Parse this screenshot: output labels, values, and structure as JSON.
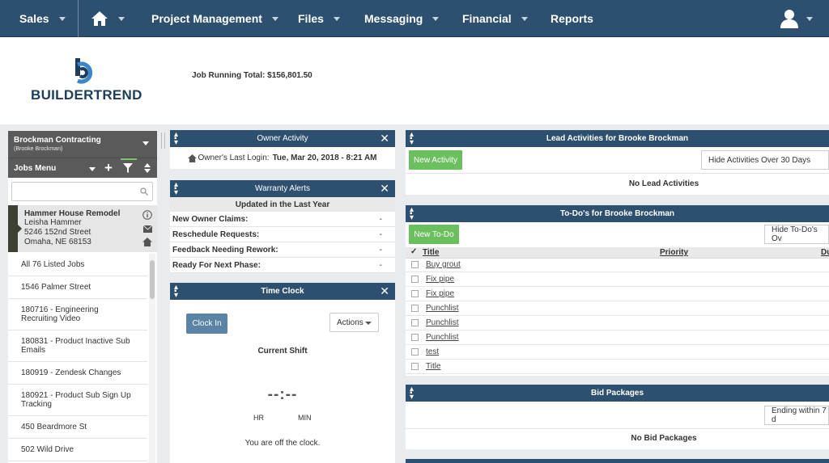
{
  "nav": {
    "sales": "Sales",
    "project_management": "Project Management",
    "files": "Files",
    "messaging": "Messaging",
    "financial": "Financial",
    "reports": "Reports"
  },
  "header": {
    "logo_text": "BUILDERTREND",
    "running_total": "Job Running Total:  $156,801.50"
  },
  "sidebar": {
    "company": "Brockman Contracting",
    "company_sub": "(Brooke Brockman)",
    "jobs_menu": "Jobs Menu",
    "search_placeholder": "",
    "selected": {
      "title": "Hammer House Remodel",
      "owner": "Leisha Hammer",
      "street": "5246 152nd Street",
      "city": "Omaha, NE 68153"
    },
    "items": [
      {
        "label": "All 76 Listed Jobs"
      },
      {
        "label": "1546 Palmer Street"
      },
      {
        "label": "180716 - Engineering Recruiting Video"
      },
      {
        "label": "180831 - Product Inactive Sub Emails"
      },
      {
        "label": "180919 - Zendesk Changes"
      },
      {
        "label": "180921 - Product Sub Sign Up Tracking"
      },
      {
        "label": "450 Beardmore St"
      },
      {
        "label": "502 Wild Drive"
      }
    ]
  },
  "owner_activity": {
    "title": "Owner Activity",
    "last_login_label": "Owner's Last Login:",
    "last_login_value": "Tue, Mar 20, 2018 - 8:21 AM"
  },
  "warranty": {
    "title": "Warranty Alerts",
    "subtitle": "Updated in the Last Year",
    "rows": [
      {
        "label": "New Owner Claims:",
        "value": "-"
      },
      {
        "label": "Reschedule Requests:",
        "value": "-"
      },
      {
        "label": "Feedback Needing Rework:",
        "value": "-"
      },
      {
        "label": "Ready For Next Phase:",
        "value": "-"
      }
    ]
  },
  "time_clock": {
    "title": "Time Clock",
    "clock_in": "Clock In",
    "actions": "Actions",
    "current_shift": "Current Shift",
    "time_display": "--:--",
    "hr": "HR",
    "min": "MIN",
    "status": "You are off the clock."
  },
  "lead_activities": {
    "title": "Lead Activities for Brooke Brockman",
    "new_button": "New Activity",
    "filter": "Hide Activities Over 30 Days",
    "empty": "No Lead Activities"
  },
  "todos": {
    "title": "To-Do's for Brooke Brockman",
    "new_button": "New To-Do",
    "filter": "Hide To-Do's Ov",
    "columns": {
      "title": "Title",
      "priority": "Priority",
      "due": "Du"
    },
    "rows": [
      {
        "title": "Buy grout"
      },
      {
        "title": "Fix pipe"
      },
      {
        "title": "Fix pipe"
      },
      {
        "title": "Punchlist"
      },
      {
        "title": "Punchlist"
      },
      {
        "title": "Punchlist"
      },
      {
        "title": "test"
      },
      {
        "title": "Title"
      }
    ]
  },
  "bid_packages": {
    "title": "Bid Packages",
    "filter": "Ending within 7 d",
    "empty": "No Bid Packages"
  },
  "colors": {
    "nav_bg": "#2d5070",
    "green": "#6cbf5f",
    "blue_button": "#5b83a5"
  }
}
